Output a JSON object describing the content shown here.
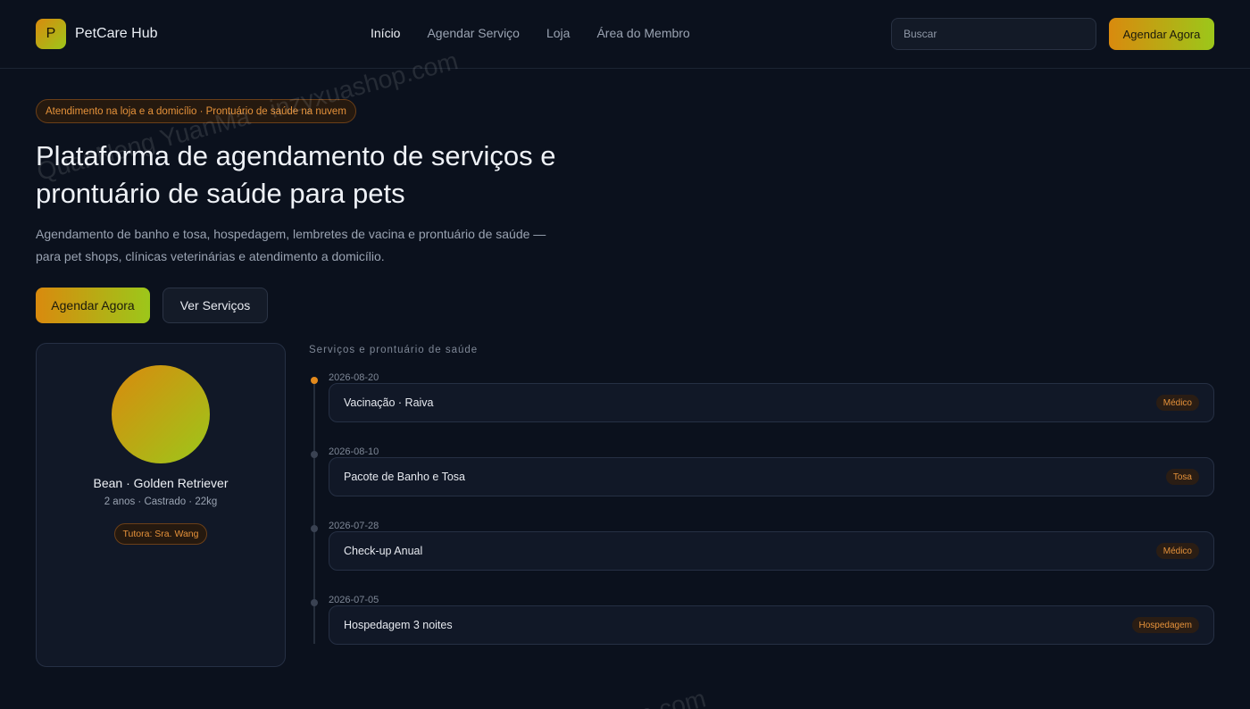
{
  "header": {
    "brand_letter": "P",
    "brand_name": "PetCare Hub",
    "nav": [
      "Início",
      "Agendar Serviço",
      "Loja",
      "Área do Membro"
    ],
    "search_placeholder": "Buscar",
    "cta_label": "Agendar Agora"
  },
  "hero": {
    "pill": "Atendimento na loja e a domicílio · Prontuário de saúde na nuvem",
    "title": "Plataforma de agendamento de serviços e prontuário de saúde para pets",
    "description": "Agendamento de banho e tosa, hospedagem, lembretes de vacina e prontuário de saúde — para pet shops, clínicas veterinárias e atendimento a domicílio.",
    "primary_label": "Agendar Agora",
    "secondary_label": "Ver Serviços"
  },
  "pet": {
    "name": "Bean · Golden Retriever",
    "meta": "2 anos · Castrado · 22kg",
    "owner": "Tutora: Sra. Wang"
  },
  "timeline": {
    "heading": "Serviços e prontuário de saúde",
    "items": [
      {
        "date": "2026-08-20",
        "title": "Vacinação · Raiva",
        "tag": "Médico"
      },
      {
        "date": "2026-08-10",
        "title": "Pacote de Banho e Tosa",
        "tag": "Tosa"
      },
      {
        "date": "2026-07-28",
        "title": "Check-up Anual",
        "tag": "Médico"
      },
      {
        "date": "2026-07-05",
        "title": "Hospedagem 3 noites",
        "tag": "Hospedagem"
      }
    ]
  },
  "watermark": {
    "text_1": "QuanNeng YuanMa · inzyxuashop.com",
    "text_2": "p.com"
  },
  "colors": {
    "background": "#0b111d",
    "accent_orange": "#d98a0e",
    "accent_green": "#9cc71a",
    "tag_text": "#e6923a"
  }
}
